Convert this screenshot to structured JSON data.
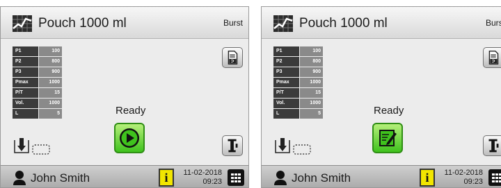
{
  "screens": [
    {
      "title": "Pouch 1000 ml",
      "mode": "Burst",
      "params": [
        {
          "label": "P1",
          "value": "100"
        },
        {
          "label": "P2",
          "value": "800"
        },
        {
          "label": "P3",
          "value": "900"
        },
        {
          "label": "Pmax",
          "value": "1000"
        },
        {
          "label": "P/T",
          "value": "15"
        },
        {
          "label": "Vol.",
          "value": "1000"
        },
        {
          "label": "L",
          "value": "5"
        }
      ],
      "status": "Ready",
      "action": "play-icon",
      "user": "John Smith",
      "date": "11-02-2018",
      "time": "09:23"
    },
    {
      "title": "Pouch 1000 ml",
      "mode": "Burst",
      "params": [
        {
          "label": "P1",
          "value": "100"
        },
        {
          "label": "P2",
          "value": "800"
        },
        {
          "label": "P3",
          "value": "900"
        },
        {
          "label": "Pmax",
          "value": "1000"
        },
        {
          "label": "P/T",
          "value": "15"
        },
        {
          "label": "Vol.",
          "value": "1000"
        },
        {
          "label": "L",
          "value": "5"
        }
      ],
      "status": "Ready",
      "action": "edit-icon",
      "user": "John Smith",
      "date": "11-02-2018",
      "time": "09:23"
    }
  ],
  "info_label": "i",
  "colors": {
    "action_green": "#3fc21d",
    "info_yellow": "#f2e600",
    "param_label_bg": "#3b3b3b",
    "param_value_bg": "#8a8a8a"
  }
}
